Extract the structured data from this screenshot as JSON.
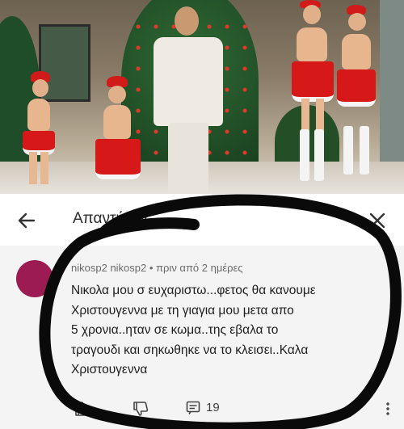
{
  "video": {
    "scene": "christmas-performance-still"
  },
  "reply_header": {
    "title": "Απαντήσεις"
  },
  "comment": {
    "author": "nikosp2",
    "handle": "nikosp2",
    "time": "πριν από 2 ημέρες",
    "lines": [
      "Νικολα μου σ ευχαριστω...φετος θα κανουμε",
      "Χριστουγεννα με τη γιαγια μου μετα απο",
      "5 χρονια..ηταν σε κωμα..της εβαλα το",
      "τραγουδι και σηκωθηκε να το κλεισει..Καλα",
      "Χριστουγεννα"
    ],
    "reply_count": "19"
  },
  "icons": [
    "back-arrow-icon",
    "close-icon",
    "like-icon",
    "dislike-icon",
    "reply-icon",
    "more-icon"
  ],
  "colors": {
    "avatar": "#9c1b53",
    "overlay_marker": "#0a0a0a"
  }
}
